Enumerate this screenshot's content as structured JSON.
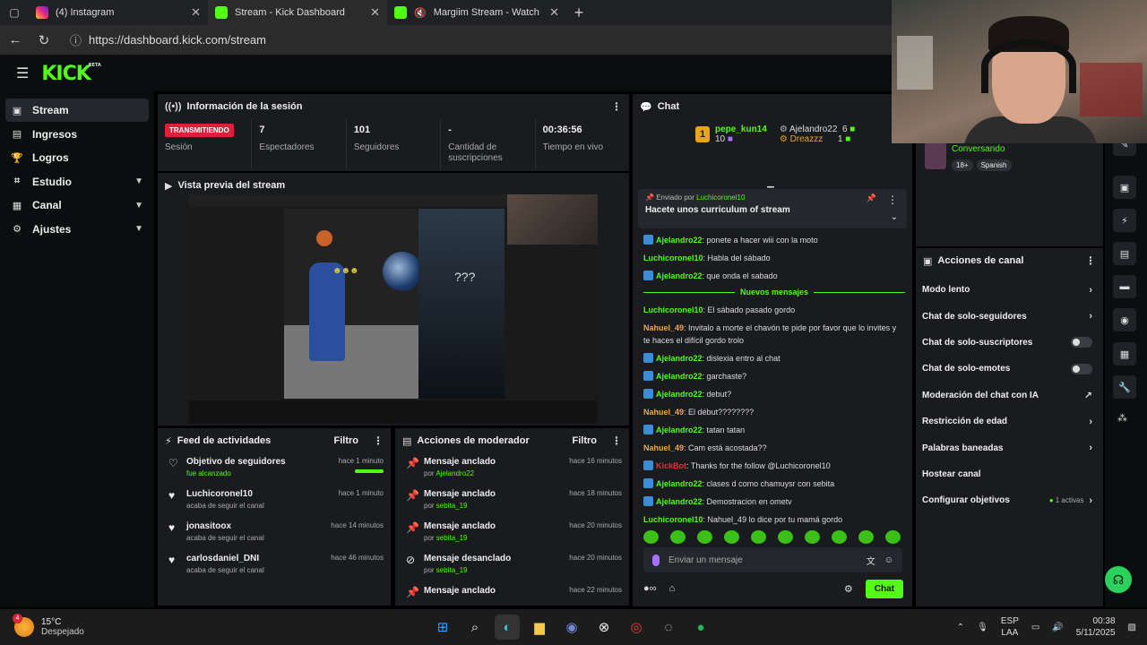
{
  "browser": {
    "tabs": [
      {
        "title": "(4) Instagram",
        "favicon_color": "#d62976"
      },
      {
        "title": "Stream - Kick Dashboard",
        "favicon_color": "#53fc18"
      },
      {
        "title": "Margiim Stream - Watch Live",
        "favicon_color": "#53fc18"
      }
    ],
    "url": "https://dashboard.kick.com/stream"
  },
  "kick": {
    "logo": "KICK",
    "logo_badge": "BETA"
  },
  "sidebar": {
    "items": [
      {
        "label": "Stream",
        "icon": "video-icon",
        "active": true
      },
      {
        "label": "Ingresos",
        "icon": "money-icon"
      },
      {
        "label": "Logros",
        "icon": "trophy-icon"
      },
      {
        "label": "Estudio",
        "icon": "studio-icon",
        "expandable": true
      },
      {
        "label": "Canal",
        "icon": "channel-icon",
        "expandable": true
      },
      {
        "label": "Ajustes",
        "icon": "gear-icon",
        "expandable": true
      }
    ]
  },
  "session": {
    "title": "Información de la sesión",
    "status_badge": "TRANSMITIENDO",
    "status_label": "Sesión",
    "stats": [
      {
        "value": "7",
        "label": "Espectadores"
      },
      {
        "value": "101",
        "label": "Seguidores"
      },
      {
        "value": "-",
        "label": "Cantidad de suscripciones"
      },
      {
        "value": "00:36:56",
        "label": "Tiempo en vivo"
      }
    ]
  },
  "preview": {
    "title": "Vista previa del stream",
    "overlay_text": "???"
  },
  "feed": {
    "title": "Feed de actividades",
    "filter": "Filtro",
    "items": [
      {
        "name": "Objetivo de seguidores",
        "sub": "fue alcanzado",
        "time": "hace 1 minuto",
        "progress": 1.0
      },
      {
        "name": "Luchicoronel10",
        "sub": "acaba de seguir el canal",
        "time": "hace 1 minuto"
      },
      {
        "name": "jonasitoox",
        "sub": "acaba de seguir el canal",
        "time": "hace 14 minutos"
      },
      {
        "name": "carlosdaniel_DNI",
        "sub": "acaba de seguir el canal",
        "time": "hace 46 minutos"
      }
    ]
  },
  "mod": {
    "title": "Acciones de moderador",
    "filter": "Filtro",
    "items": [
      {
        "action": "Mensaje anclado",
        "by": "por",
        "user": "Ajelandro22",
        "time": "hace 16 minutos"
      },
      {
        "action": "Mensaje anclado",
        "by": "por",
        "user": "sebita_19",
        "time": "hace 18 minutos"
      },
      {
        "action": "Mensaje anclado",
        "by": "por",
        "user": "sebita_19",
        "time": "hace 20 minutos"
      },
      {
        "action": "Mensaje desanclado",
        "by": "por",
        "user": "sebita_19",
        "time": "hace 20 minutos"
      },
      {
        "action": "Mensaje anclado",
        "by": "",
        "user": "",
        "time": "hace 22 minutos"
      }
    ]
  },
  "chat": {
    "title": "Chat",
    "leaderboard": {
      "first_place": "1",
      "first_user": "pepe_kun14",
      "first_count": "10",
      "second_user": "Ajelandro22",
      "second_count": "6",
      "third_user": "Dreazzz",
      "third_count": "1"
    },
    "pinned": {
      "sent_by_prefix": "Enviado por",
      "sent_by_user": "Luchicoronel10",
      "message": "Hacete unos curriculum of stream"
    },
    "new_messages_label": "Nuevos mensajes",
    "messages_before": [
      {
        "user": "Ajelandro22",
        "color": "#53fc18",
        "badge": true,
        "text": "ponete a hacer wiii con la moto"
      },
      {
        "user": "Luchicoronel10",
        "color": "#53fc18",
        "badge": false,
        "text": "Habla del sábado"
      },
      {
        "user": "Ajelandro22",
        "color": "#53fc18",
        "badge": true,
        "text": "que onda el sabado"
      }
    ],
    "messages_after": [
      {
        "user": "Luchicoronel10",
        "color": "#53fc18",
        "badge": false,
        "text": "El sábado pasado gordo"
      },
      {
        "user": "Nahuel_49",
        "color": "#f0a64b",
        "badge": false,
        "text": "Invitalo a morte el chavón te pide por favor que lo invites y te haces el difícil gordo trolo"
      },
      {
        "user": "Ajelandro22",
        "color": "#53fc18",
        "badge": true,
        "text": "dislexia entro al chat"
      },
      {
        "user": "Ajelandro22",
        "color": "#53fc18",
        "badge": true,
        "text": "garchaste?"
      },
      {
        "user": "Ajelandro22",
        "color": "#53fc18",
        "badge": true,
        "text": "debut?"
      },
      {
        "user": "Nahuel_49",
        "color": "#f0a64b",
        "badge": false,
        "text": "El début????????"
      },
      {
        "user": "Ajelandro22",
        "color": "#53fc18",
        "badge": true,
        "text": "tatan tatan"
      },
      {
        "user": "Nahuel_49",
        "color": "#f0a64b",
        "badge": false,
        "text": "Cam está acostada??"
      },
      {
        "user": "KickBot",
        "color": "#e0323c",
        "badge": true,
        "text": "Thanks for the follow @Luchicoronel10"
      },
      {
        "user": "Ajelandro22",
        "color": "#53fc18",
        "badge": true,
        "text": "clases d como chamuysr con sebita"
      },
      {
        "user": "Ajelandro22",
        "color": "#53fc18",
        "badge": true,
        "text": "Demostracion en ometv"
      },
      {
        "user": "Luchicoronel10",
        "color": "#53fc18",
        "badge": false,
        "text": "Nahuel_49 lo dice por tu mamá gordo"
      }
    ],
    "input_placeholder": "Enviar un mensaje",
    "send_label": "Chat"
  },
  "streamer": {
    "category": "Conversando",
    "age": "18+",
    "language": "Spanish"
  },
  "actions": {
    "title": "Acciones de canal",
    "items": [
      {
        "label": "Modo lento",
        "kind": "chevron"
      },
      {
        "label": "Chat de solo-seguidores",
        "kind": "chevron"
      },
      {
        "label": "Chat de solo-suscriptores",
        "kind": "toggle"
      },
      {
        "label": "Chat de solo-emotes",
        "kind": "toggle"
      },
      {
        "label": "Moderación del chat con IA",
        "kind": "external"
      },
      {
        "label": "Restricción de edad",
        "kind": "chevron"
      },
      {
        "label": "Palabras baneadas",
        "kind": "chevron"
      },
      {
        "label": "Hostear canal",
        "kind": "none"
      },
      {
        "label": "Configurar objetivos",
        "kind": "chevron",
        "extra": "1 activas"
      }
    ]
  },
  "taskbar": {
    "temp": "15°C",
    "weather": "Despejado",
    "weather_badge": "4",
    "lang_top": "ESP",
    "lang_bottom": "LAA",
    "time": "00:38",
    "date": "5/11/2025"
  }
}
